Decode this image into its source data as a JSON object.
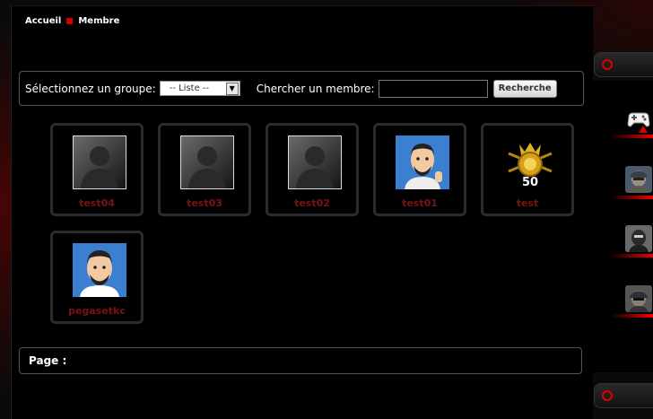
{
  "breadcrumb": {
    "home": "Accueil",
    "current": "Membre"
  },
  "filter": {
    "group_label": "Sélectionnez un groupe:",
    "group_value": "-- Liste --",
    "search_label": "Chercher un membre:",
    "search_value": "",
    "search_button": "Recherche"
  },
  "members": [
    {
      "name": "test04",
      "avatar": "default-silhouette"
    },
    {
      "name": "test03",
      "avatar": "default-silhouette"
    },
    {
      "name": "test02",
      "avatar": "default-silhouette"
    },
    {
      "name": "test01",
      "avatar": "cartoon-man-thumbs-up"
    },
    {
      "name": "test",
      "avatar": "gold-rank-50-badge"
    },
    {
      "name": "pegasetkc",
      "avatar": "cartoon-man-portrait"
    }
  ],
  "pagination": {
    "label": "Page :"
  },
  "sidebar": {
    "items": [
      {
        "icon": "gamepad-warning-icon"
      },
      {
        "icon": "soldier-icon"
      },
      {
        "icon": "masked-soldier-icon"
      },
      {
        "icon": "helmet-soldier-icon"
      }
    ]
  },
  "colors": {
    "accent": "#d00000",
    "member_name": "#7a1414",
    "background": "#000000"
  }
}
